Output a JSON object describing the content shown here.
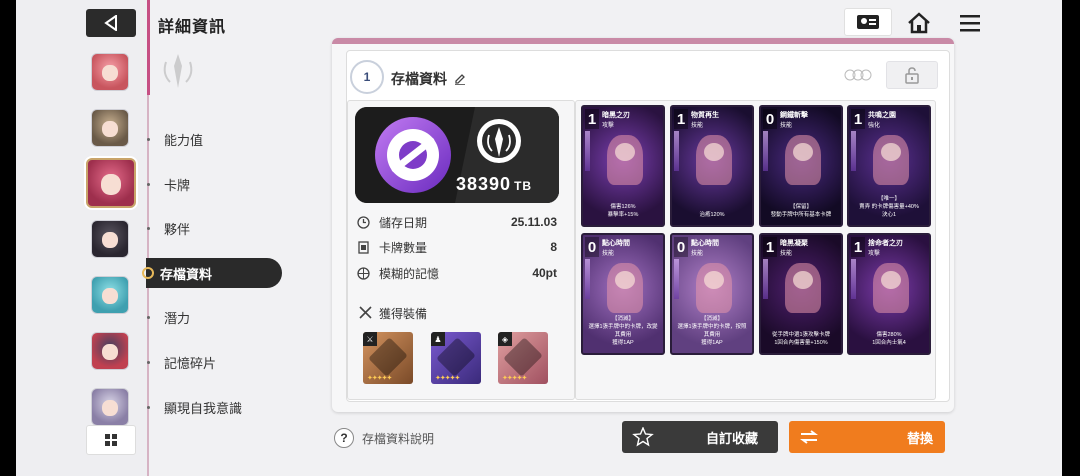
{
  "header": {
    "title": "詳細資訊"
  },
  "left_nav": {
    "avatars": [
      {
        "name": "avatar-red-hair",
        "colors": [
          "#f6a0a8",
          "#c8555e"
        ]
      },
      {
        "name": "avatar-brown-hair",
        "colors": [
          "#c8b090",
          "#6a5a48"
        ]
      },
      {
        "name": "avatar-selected-red-hair",
        "colors": [
          "#e46b8a",
          "#9e2f4d"
        ]
      },
      {
        "name": "avatar-dark-creature",
        "colors": [
          "#5a5560",
          "#2a2630"
        ]
      },
      {
        "name": "avatar-teal-hair",
        "colors": [
          "#8fe0e6",
          "#3fa0b0"
        ]
      },
      {
        "name": "avatar-black-hair",
        "colors": [
          "#404060",
          "#c04050"
        ]
      },
      {
        "name": "avatar-silver-hair",
        "colors": [
          "#d8d4e6",
          "#8a7fa6"
        ]
      }
    ]
  },
  "menu": {
    "items": [
      {
        "label": "能力值",
        "active": false
      },
      {
        "label": "卡牌",
        "active": false
      },
      {
        "label": "夥伴",
        "active": false
      },
      {
        "label": "存檔資料",
        "active": true
      },
      {
        "label": "潛力",
        "active": false
      },
      {
        "label": "記憶碎片",
        "active": false
      },
      {
        "label": "顯現自我意識",
        "active": false
      }
    ]
  },
  "panel": {
    "badge_number": "1",
    "title": "存檔資料",
    "capacity_value": "38390",
    "capacity_unit": "TB",
    "info": [
      {
        "icon": "clock-icon",
        "label": "儲存日期",
        "value": "25.11.03"
      },
      {
        "icon": "card-count-icon",
        "label": "卡牌數量",
        "value": "8"
      },
      {
        "icon": "memory-icon",
        "label": "模糊的記憶",
        "value": "40pt"
      }
    ],
    "equipment_title": "獲得裝備",
    "equipment": [
      {
        "name": "equip-weapon",
        "bg": [
          "#d49460",
          "#7a4a28"
        ]
      },
      {
        "name": "equip-armor",
        "bg": [
          "#7a5ad0",
          "#3a2a7a"
        ]
      },
      {
        "name": "equip-ring",
        "bg": [
          "#e0a0a0",
          "#a05060"
        ]
      }
    ]
  },
  "cards": [
    {
      "cost": "1",
      "name": "暗黑之刃",
      "type": "攻擊",
      "desc": "傷害126%\n暴擊率+15%",
      "bg": [
        "#7b3fb0",
        "#2a1240"
      ]
    },
    {
      "cost": "1",
      "name": "物質再生",
      "type": "技能",
      "desc": "治癒120%",
      "bg": [
        "#6a3aa0",
        "#1a0e30"
      ]
    },
    {
      "cost": "0",
      "name": "鋼鐵斬擊",
      "type": "技能",
      "desc": "【保留】\n發動手牌中所有基本卡牌",
      "bg": [
        "#4a2a80",
        "#120a24"
      ]
    },
    {
      "cost": "1",
      "name": "共鳴之園",
      "type": "強化",
      "desc": "【唯一】\n賣弄 的卡牌傷害量+40%\n決心1",
      "bg": [
        "#5a3090",
        "#1e1038"
      ]
    },
    {
      "cost": "0",
      "name": "點心時間",
      "type": "技能",
      "desc": "【消滅】\n選擇1張手牌中的卡牌，改變其費用\n獲得1AP",
      "bg": [
        "#a070c0",
        "#503070"
      ]
    },
    {
      "cost": "0",
      "name": "點心時間",
      "type": "技能",
      "desc": "【消滅】\n選擇1張手牌中的卡牌，按照其費用\n獲得1AP",
      "bg": [
        "#b080c8",
        "#604080"
      ]
    },
    {
      "cost": "1",
      "name": "暗黑凝聚",
      "type": "技能",
      "desc": "從手牌中選1張攻擊卡牌\n1回合內傷害量+150%",
      "bg": [
        "#502070",
        "#1a0a28"
      ]
    },
    {
      "cost": "1",
      "name": "捨命者之刃",
      "type": "攻擊",
      "desc": "傷害280%\n1回合內士氣4",
      "bg": [
        "#7a3aa8",
        "#2a1040"
      ]
    }
  ],
  "footer": {
    "help_label": "存檔資料說明",
    "customize_label": "自訂收藏",
    "replace_label": "替換"
  },
  "colors": {
    "accent_orange": "#f07c1e",
    "panel_pink": "#c98aa6",
    "gold": "#e7b95a"
  }
}
